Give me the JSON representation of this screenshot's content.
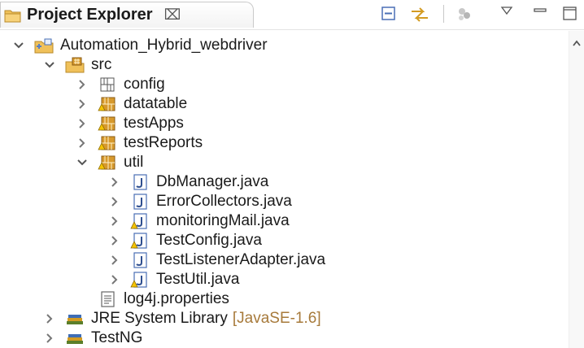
{
  "view": {
    "tab_title": "Project Explorer",
    "tab_close_glyph": "⌧",
    "toolbar_icons": [
      "collapse-all-icon",
      "link-with-editor-icon",
      "focus-icon",
      "view-menu-icon",
      "minimize-icon",
      "maximize-icon"
    ]
  },
  "tree": {
    "project": "Automation_Hybrid_webdriver",
    "src": "src",
    "packages": [
      "config",
      "datatable",
      "testApps",
      "testReports",
      "util"
    ],
    "util_files": [
      "DbManager.java",
      "ErrorCollectors.java",
      "monitoringMail.java",
      "TestConfig.java",
      "TestListenerAdapter.java",
      "TestUtil.java"
    ],
    "properties_file": "log4j.properties",
    "jre_library": "JRE System Library",
    "jre_decoration": "[JavaSE-1.6]",
    "testng": "TestNG"
  },
  "colors": {
    "chevron": "#555555",
    "folder": "#e8b64b",
    "package": "#c8922c",
    "java_file": "#4a6fb5",
    "warning": "#e1a800",
    "decoration": "#a77a3b"
  }
}
